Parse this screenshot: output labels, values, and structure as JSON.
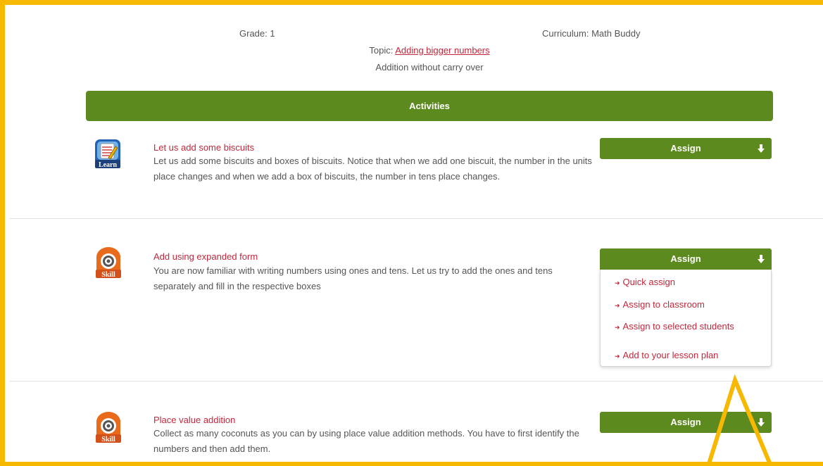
{
  "header": {
    "grade": "Grade: 1",
    "curriculum": "Curriculum: Math Buddy",
    "topic_prefix": "Topic: ",
    "topic_link": "Adding bigger numbers",
    "subtopic": "Addition without carry over"
  },
  "section_title": "Activities",
  "activities": [
    {
      "badge": "Learn",
      "icon": "learn-notepad-icon",
      "title": "Let us add some biscuits",
      "description": "Let us add some biscuits and boxes of biscuits. Notice that when we add one biscuit, the number in the units place changes and when we add a box of biscuits, the number in tens place changes.",
      "assign_label": "Assign"
    },
    {
      "badge": "Skill",
      "icon": "skill-target-icon",
      "title": "Add using expanded form",
      "description": "You are now familiar with writing numbers using ones and tens. Let us try to add the ones and tens separately and fill in the respective boxes",
      "assign_label": "Assign"
    },
    {
      "badge": "Skill",
      "icon": "skill-target-icon",
      "title": "Place value addition",
      "description": "Collect as many coconuts as you can by using place value addition methods. You have to first identify the numbers and then add them.",
      "assign_label": "Assign"
    }
  ],
  "assign_menu": {
    "items": [
      "Quick assign",
      "Assign to classroom",
      "Assign to selected students",
      "Add to your lesson plan"
    ]
  },
  "colors": {
    "brand_green": "#5c8a1e",
    "link_red": "#c0283c",
    "highlight_orange": "#f6b800"
  }
}
